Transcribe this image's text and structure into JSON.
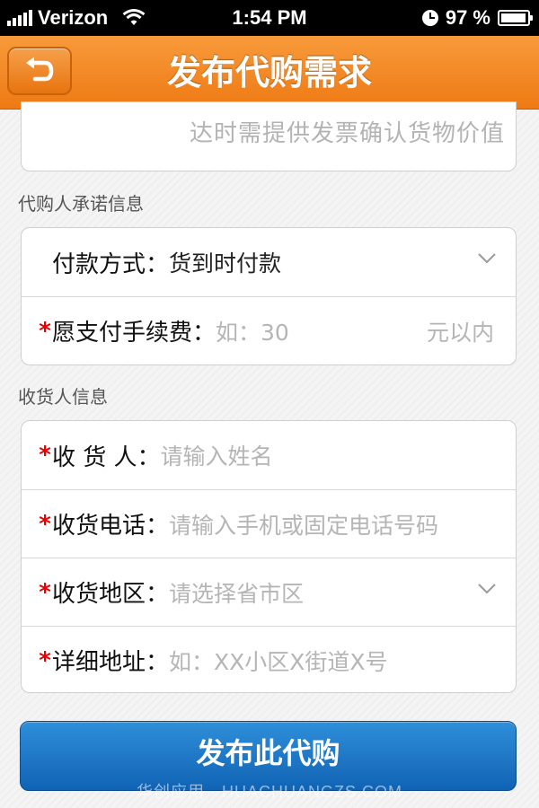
{
  "status_bar": {
    "carrier": "Verizon",
    "time": "1:54 PM",
    "battery_text": "97 %",
    "battery_level": 0.97
  },
  "nav": {
    "title": "发布代购需求",
    "back_icon": "back-return-icon"
  },
  "textarea_tail": {
    "text": "达时需提供发票确认货物价值"
  },
  "section_promise": {
    "label": "代购人承诺信息"
  },
  "payment": {
    "label": "付款方式：",
    "value": "货到时付款"
  },
  "fee": {
    "required_mark": "*",
    "label": "愿支付手续费：",
    "placeholder": "如：30",
    "suffix": "元以内"
  },
  "section_receiver": {
    "label": "收货人信息"
  },
  "receiver_name": {
    "required_mark": "*",
    "label": "收 货 人：",
    "placeholder": "请输入姓名"
  },
  "receiver_phone": {
    "required_mark": "*",
    "label": "收货电话：",
    "placeholder": "请输入手机或固定电话号码"
  },
  "receiver_region": {
    "required_mark": "*",
    "label": "收货地区：",
    "placeholder": "请选择省市区"
  },
  "receiver_address": {
    "required_mark": "*",
    "label": "详细地址：",
    "placeholder": "如：XX小区X街道X号"
  },
  "submit": {
    "label": "发布此代购"
  },
  "watermark": {
    "text": "华创应用 · HUACHUANGZS.COM"
  },
  "colors": {
    "nav_orange": "#f08a24",
    "submit_blue": "#1c76c8",
    "required_red": "#e60000"
  }
}
